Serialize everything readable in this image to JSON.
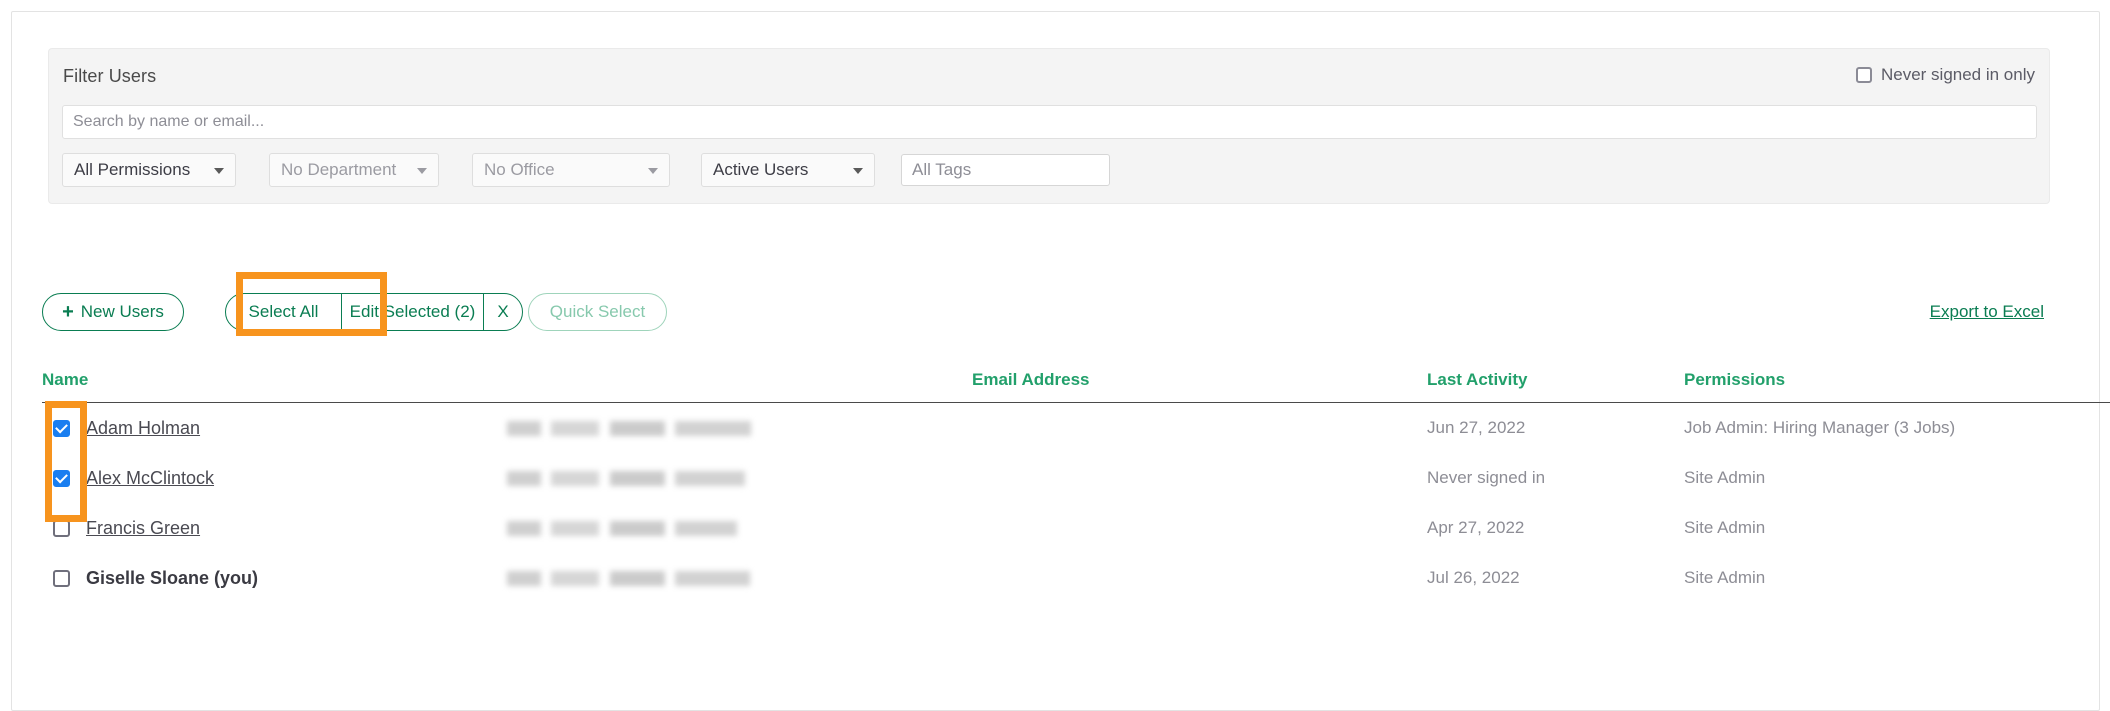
{
  "filter_panel": {
    "title": "Filter Users",
    "never_signed_in_only": {
      "label": "Never signed in only",
      "checked": false
    },
    "search": {
      "value": "",
      "placeholder": "Search by name or email..."
    },
    "selects": [
      {
        "name": "permissions",
        "value": "All Permissions",
        "state": "selected"
      },
      {
        "name": "department",
        "value": "No Department",
        "state": "placeholder"
      },
      {
        "name": "office",
        "value": "No Office",
        "state": "placeholder"
      },
      {
        "name": "status",
        "value": "Active Users",
        "state": "selected"
      }
    ],
    "tags": {
      "value": "",
      "placeholder": "All Tags"
    }
  },
  "action_bar": {
    "new_users_label": "New Users",
    "new_users_icon": "plus-icon",
    "select_all_label": "Select All",
    "edit_selected_label": "Edit Selected (2)",
    "clear_selection_label": "X",
    "quick_select_label": "Quick Select",
    "export_label": "Export to Excel"
  },
  "table": {
    "columns": [
      "Name",
      "Email Address",
      "Last Activity",
      "Permissions"
    ],
    "rows": [
      {
        "name": "Adam Holman",
        "checked": true,
        "is_self": false,
        "email": "",
        "last_activity": "Jun 27, 2022",
        "permissions": "Job Admin: Hiring Manager (3 Jobs)"
      },
      {
        "name": "Alex McClintock",
        "checked": true,
        "is_self": false,
        "email": "",
        "last_activity": "Never signed in",
        "permissions": "Site Admin"
      },
      {
        "name": "Francis Green",
        "checked": false,
        "is_self": false,
        "email": "",
        "last_activity": "Apr 27, 2022",
        "permissions": "Site Admin"
      },
      {
        "name": "Giselle Sloane (you)",
        "checked": false,
        "is_self": true,
        "email": "",
        "last_activity": "Jul 26, 2022",
        "permissions": "Site Admin"
      }
    ]
  },
  "highlights": {
    "color": "#F7941E",
    "targets": [
      "select-all-button",
      "row-checkbox-column"
    ]
  }
}
